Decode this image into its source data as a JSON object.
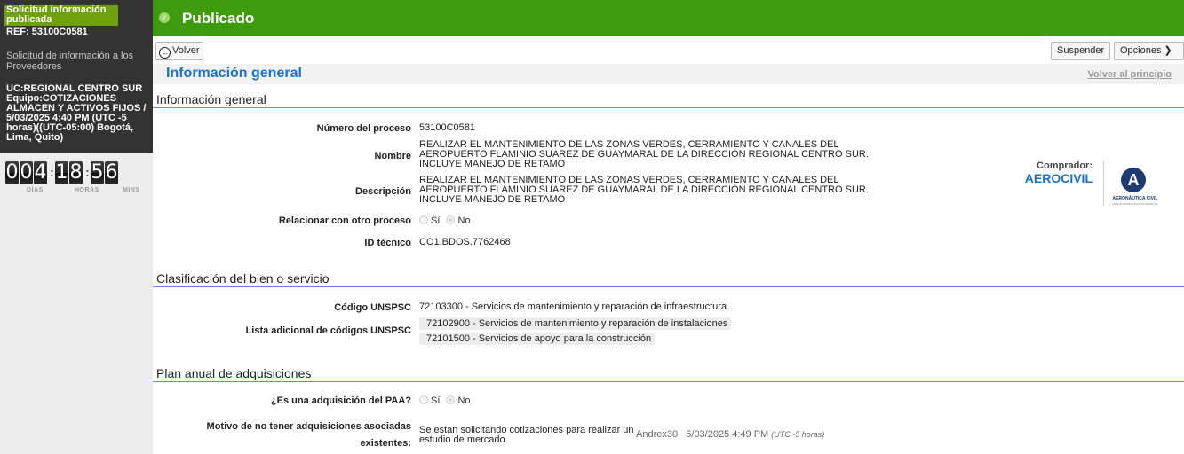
{
  "sidebar": {
    "status_badge": "Solicitud información publicada",
    "ref": "REF: 53100C0581",
    "subtitle": "Solicitud de información a los Proveedores",
    "info": "UC:REGIONAL CENTRO SUR Equipo:COTIZACIONES ALMACEN Y ACTIVOS FIJOS / 5/03/2025 4:40 PM (UTC -5 horas)((UTC-05:00) Bogotá, Lima, Quito)",
    "timer": {
      "days": [
        "0",
        "0",
        "4"
      ],
      "hours": [
        "1",
        "8"
      ],
      "mins": [
        "5",
        "6"
      ],
      "days_label": "DÍAS",
      "hours_label": "HORAS",
      "mins_label": "MINS"
    }
  },
  "header": {
    "title": "Publicado"
  },
  "toolbar": {
    "back": "Volver",
    "suspend": "Suspender",
    "options": "Opciones ❯"
  },
  "info_band": {
    "title": "Información general",
    "back_to_top": "Volver al principio"
  },
  "general": {
    "section_title": "Información general",
    "process_number_label": "Número del proceso",
    "process_number": "53100C0581",
    "name_label": "Nombre",
    "name_lines": [
      "REALIZAR EL MANTENIMIENTO DE LAS ZONAS VERDES, CERRAMIENTO Y CANALES DEL",
      "AEROPUERTO FLAMINIO SUAREZ DE GUAYMARAL DE LA DIRECCIÓN REGIONAL CENTRO SUR.",
      "INCLUYE MANEJO DE RETAMO"
    ],
    "description_label": "Descripción",
    "description_lines": [
      "REALIZAR EL MANTENIMIENTO DE LAS ZONAS VERDES, CERRAMIENTO Y CANALES DEL",
      "AEROPUERTO FLAMINIO SUAREZ DE GUAYMARAL DE LA DIRECCIÓN REGIONAL CENTRO SUR.",
      "INCLUYE MANEJO DE RETAMO"
    ],
    "relate_label": "Relacionar con otro proceso",
    "yes": "Sí",
    "no": "No",
    "tech_id_label": "ID técnico",
    "tech_id": "CO1.BDOS.7762468"
  },
  "buyer": {
    "label": "Comprador:",
    "name": "AEROCIVIL",
    "logo_text": "AERONÁUTICA CIVIL",
    "logo_subtext": "UNIDAD ADMINISTRATIVA ESPECIAL"
  },
  "classification": {
    "section_title": "Clasificación del bien o servicio",
    "unspsc_label": "Código UNSPSC",
    "unspsc": "72103300 - Servicios de mantenimiento y reparación de infraestructura",
    "additional_label": "Lista adicional de códigos UNSPSC",
    "additional": [
      "72102900 - Servicios de mantenimiento y reparación de instalaciones",
      "72101500 - Servicios de apoyo para la construcción"
    ]
  },
  "plan": {
    "section_title": "Plan anual de adquisiciones",
    "paa_label": "¿Es una adquisición del PAA?",
    "reason_label_1": "Motivo de no tener adquisiciones asociadas",
    "reason_label_2": "existentes:",
    "reason_lines": [
      "Se estan solicitando cotizaciones para realizar un",
      "estudio de mercado"
    ],
    "user": "Andrex30",
    "date": "5/03/2025 4:49 PM",
    "tz": "(UTC -5 horas)"
  },
  "colors": {
    "header_green": "#3f9b0e",
    "accent_blue": "#1a73c9",
    "sidebar_dark": "#333333"
  }
}
